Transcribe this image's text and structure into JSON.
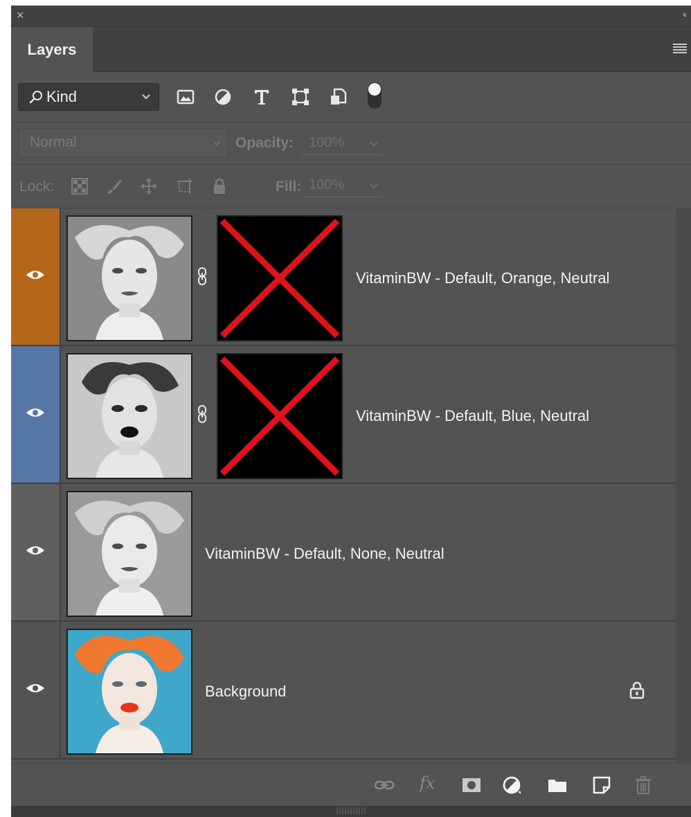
{
  "window": {
    "close_glyph": "×",
    "collapse_glyph": "‹‹"
  },
  "tab": {
    "label": "Layers"
  },
  "filter": {
    "kind_label": "Kind",
    "icons": [
      "image-filter-icon",
      "adjustment-filter-icon",
      "type-filter-icon",
      "shape-filter-icon",
      "smart-object-filter-icon",
      "filter-toggle-icon"
    ]
  },
  "blend": {
    "mode": "Normal",
    "opacity_label": "Opacity:",
    "opacity_value": "100%"
  },
  "lock": {
    "label": "Lock:",
    "fill_label": "Fill:",
    "fill_value": "100%"
  },
  "layers": [
    {
      "name": "VitaminBW - Default, Orange, Neutral",
      "color": "#b4661a",
      "has_mask": true,
      "locked": false
    },
    {
      "name": "VitaminBW - Default, Blue, Neutral",
      "color": "#5577a6",
      "has_mask": true,
      "locked": false
    },
    {
      "name": "VitaminBW - Default, None, Neutral",
      "color": "#5f5f5f",
      "has_mask": false,
      "locked": false
    },
    {
      "name": "Background",
      "color": "#535353",
      "has_mask": false,
      "locked": true
    }
  ],
  "footer": {
    "icons": [
      "link-layers-icon",
      "fx-icon",
      "add-mask-icon",
      "adjustment-layer-icon",
      "group-folder-icon",
      "new-layer-icon",
      "trash-icon"
    ],
    "fx_text": "fx"
  },
  "colors": {
    "panel_bg": "#535353",
    "header_bg": "#424242",
    "mask_x": "#e0121b"
  }
}
